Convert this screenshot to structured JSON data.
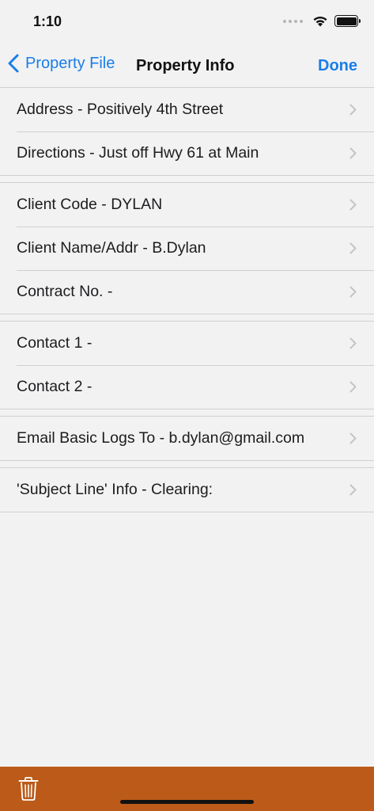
{
  "status_bar": {
    "time": "1:10"
  },
  "nav": {
    "back_label": "Property File",
    "title": "Property Info",
    "done_label": "Done"
  },
  "groups": [
    [
      {
        "label": "Address - Positively 4th Street"
      },
      {
        "label": "Directions - Just off Hwy 61 at Main"
      }
    ],
    [
      {
        "label": "Client Code - DYLAN"
      },
      {
        "label": "Client Name/Addr - B.Dylan"
      },
      {
        "label": "Contract No. -"
      }
    ],
    [
      {
        "label": "Contact 1 -"
      },
      {
        "label": "Contact 2 -"
      }
    ],
    [
      {
        "label": "Email Basic Logs To - b.dylan@gmail.com"
      }
    ],
    [
      {
        "label": "'Subject Line' Info - Clearing:"
      }
    ]
  ],
  "colors": {
    "accent": "#1a7ee8",
    "toolbar": "#bb5a19",
    "background": "#f2f2f3"
  },
  "icons": {
    "back": "chevron-left-icon",
    "row": "chevron-right-icon",
    "toolbar": "trash-icon"
  }
}
